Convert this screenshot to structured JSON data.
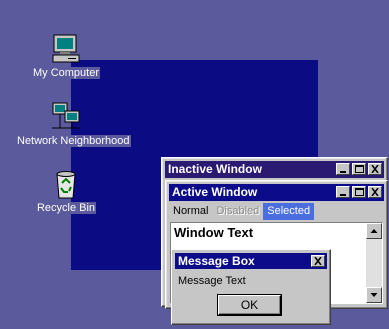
{
  "desktop": {
    "icons": [
      {
        "label": "My Computer"
      },
      {
        "label": "Network Neighborhood"
      },
      {
        "label": "Recycle Bin"
      }
    ]
  },
  "inactive_window": {
    "title": "Inactive Window"
  },
  "active_window": {
    "title": "Active Window",
    "menu": {
      "normal": "Normal",
      "disabled": "Disabled",
      "selected": "Selected"
    },
    "window_text": "Window Text"
  },
  "message_box": {
    "title": "Message Box",
    "text": "Message Text",
    "ok_label": "OK"
  },
  "colors": {
    "desktop": "#5a5a9c",
    "active_title": "#0c0c8a",
    "inactive_title": "#2b1a72",
    "selected_menu": "#4a6ee0"
  }
}
